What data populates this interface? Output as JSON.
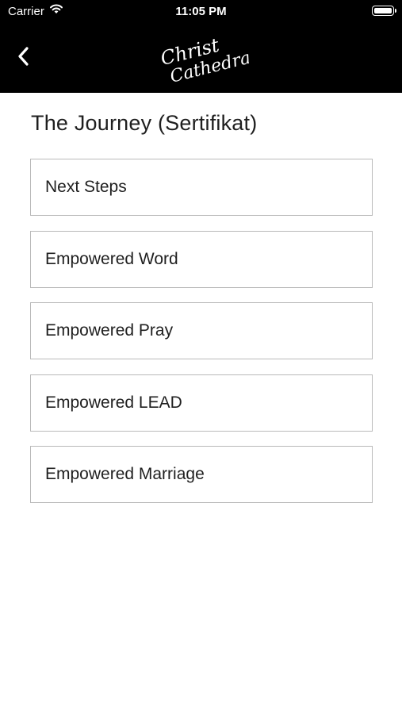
{
  "status_bar": {
    "carrier": "Carrier",
    "time": "11:05 PM"
  },
  "header": {
    "logo_line1": "Christ",
    "logo_line2": "Cathedral",
    "back_icon": "chevron-left-icon"
  },
  "page": {
    "title": "The Journey (Sertifikat)"
  },
  "menu": {
    "items": [
      {
        "label": "Next Steps"
      },
      {
        "label": "Empowered Word"
      },
      {
        "label": "Empowered Pray"
      },
      {
        "label": "Empowered LEAD"
      },
      {
        "label": "Empowered Marriage"
      }
    ]
  },
  "colors": {
    "header_bg": "#000000",
    "border": "#b9b9b9",
    "text": "#1f1f1f"
  }
}
